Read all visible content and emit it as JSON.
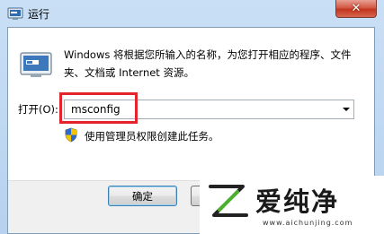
{
  "window": {
    "title": "运行",
    "close_glyph": "✕",
    "description": "Windows 将根据您所输入的名称，为您打开相应的程序、文件夹、文档或 Internet 资源。",
    "open_label": "打开(O):",
    "command_value": "msconfig",
    "admin_note": "使用管理员权限创建此任务。",
    "ok_label": "确定",
    "cancel_label": ""
  },
  "watermark": {
    "brand": "爱纯净",
    "url": "www.aichunjing.com"
  },
  "colors": {
    "highlight": "#e5232b",
    "title_bar": "#b7d1ee",
    "close_button": "#c2351e"
  }
}
